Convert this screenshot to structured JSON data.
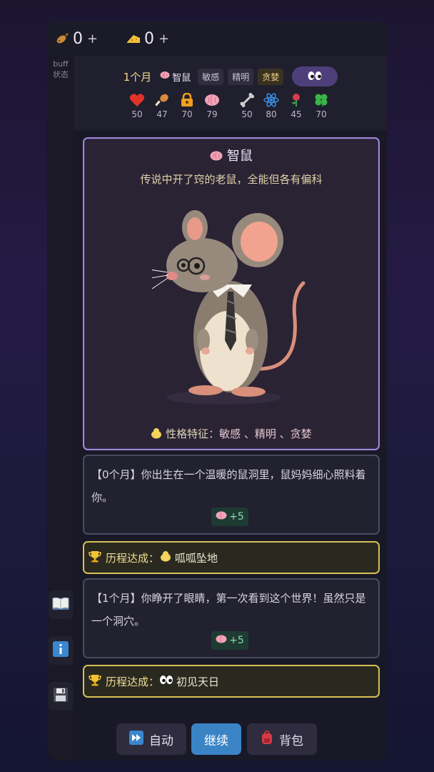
{
  "resources": [
    {
      "name": "fish",
      "icon": "fish-icon",
      "value": "0",
      "plus": "+"
    },
    {
      "name": "cheese",
      "icon": "cheese-icon",
      "value": "0",
      "plus": "+"
    }
  ],
  "side": {
    "buff": "buff",
    "status": "状态"
  },
  "header": {
    "age": "1个月",
    "species": "智鼠",
    "tags": [
      "敏感",
      "精明",
      "贪婪"
    ],
    "eyes_button_icon": "eyes-icon"
  },
  "stats": [
    {
      "icon": "heart-icon",
      "value": "50",
      "color": "#e0342b"
    },
    {
      "icon": "drumstick-icon",
      "value": "47",
      "color": "#e8a44a"
    },
    {
      "icon": "lock-icon",
      "value": "70",
      "color": "#f0a020"
    },
    {
      "icon": "brain-icon",
      "value": "79",
      "color": "#f3a3b8"
    },
    {
      "icon": "bone-icon",
      "value": "50",
      "color": "#c9c9c9"
    },
    {
      "icon": "atom-icon",
      "value": "80",
      "color": "#3a8de0"
    },
    {
      "icon": "rose-icon",
      "value": "45",
      "color": "#d93c4a"
    },
    {
      "icon": "clover-icon",
      "value": "70",
      "color": "#3ab54a"
    }
  ],
  "card": {
    "title": "智鼠",
    "description": "传说中开了窍的老鼠，全能但各有偏科",
    "traits_label": "性格特征：",
    "traits": "敏感 、精明 、贪婪"
  },
  "events": [
    {
      "text": "【0个月】你出生在一个温暖的鼠洞里，鼠妈妈细心照料着你。",
      "bonus": "+5"
    },
    {
      "text": "【1个月】你睁开了眼睛，第一次看到这个世界！虽然只是一个洞穴。",
      "bonus": "+5"
    }
  ],
  "achievements": [
    {
      "label": "历程达成：",
      "name": "呱呱坠地"
    },
    {
      "label": "历程达成：",
      "name": "初见天日"
    }
  ],
  "buttons": {
    "auto": "自动",
    "continue": "继续",
    "bag": "背包"
  },
  "colors": {
    "accent_purple": "#9d86d4",
    "achievement_gold": "#d7c054",
    "continue_blue": "#3a84c6"
  }
}
